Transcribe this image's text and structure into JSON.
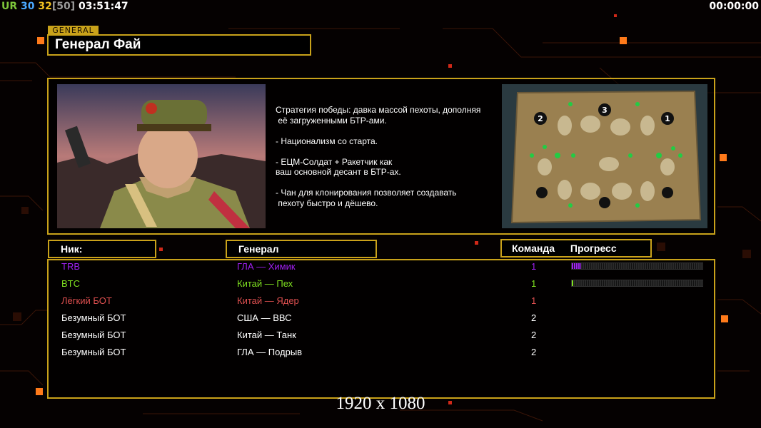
{
  "hud": {
    "ur_label": "UR",
    "val1": "30",
    "val2": "32",
    "val3": "[50]",
    "clock": "03:51:47",
    "timer": "00:00:00"
  },
  "tab_label": "GENERAL",
  "general_title": "Генерал Фай",
  "strategy_text": "Стратегия победы: давка массой пехоты, дополняя\n её загруженными БТР-ами.\n\n- Национализм со старта.\n\n- ЕЦМ-Солдат + Ракетчик как\nваш основной десант в БТР-ах.\n\n- Чан для клонирования позволяет создавать\n пехоту быстро и дёшево.",
  "map_markers": [
    "2",
    "3",
    "1"
  ],
  "headers": {
    "nick": "Ник:",
    "general": "Генерал",
    "team": "Команда",
    "progress": "Прогресс"
  },
  "players": [
    {
      "nick": "TRB",
      "general": "ГЛА — Химик",
      "team": "1",
      "color": "#a020f0",
      "progress": 0.07
    },
    {
      "nick": "BTC",
      "general": "Китай — Пех",
      "team": "1",
      "color": "#7fe020",
      "progress": 0.01
    },
    {
      "nick": "Лёгкий БОТ",
      "general": "Китай — Ядер",
      "team": "1",
      "color": "#e05050",
      "progress": null
    },
    {
      "nick": "Безумный БОТ",
      "general": "США — ВВС",
      "team": "2",
      "color": "#ffffff",
      "progress": null
    },
    {
      "nick": "Безумный БОТ",
      "general": "Китай — Танк",
      "team": "2",
      "color": "#ffffff",
      "progress": null
    },
    {
      "nick": "Безумный БОТ",
      "general": "ГЛА — Подрыв",
      "team": "2",
      "color": "#ffffff",
      "progress": null
    }
  ],
  "watermark": "1920 x 1080",
  "colors": {
    "accent": "#c9a21a",
    "circuit": "#ff6a1a"
  }
}
